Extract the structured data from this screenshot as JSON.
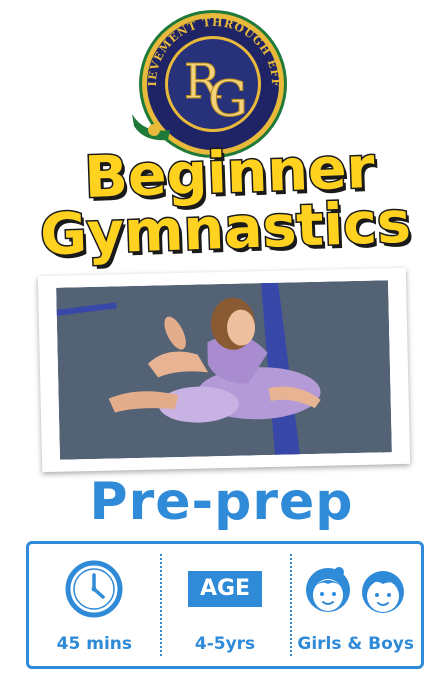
{
  "logo": {
    "motto": "ACHIEVEMENT THROUGH EFFORT",
    "monogram_r": "R",
    "monogram_g": "G"
  },
  "title": {
    "line1": "Beginner",
    "line2": "Gymnastics"
  },
  "subtitle": "Pre-prep",
  "info": {
    "duration": {
      "icon": "clock-icon",
      "label": "45 mins"
    },
    "age": {
      "badge": "AGE",
      "label": "4-5yrs"
    },
    "audience": {
      "icon": "girl-boy-faces-icon",
      "label": "Girls & Boys"
    }
  },
  "colors": {
    "title_yellow": "#ffd21f",
    "brand_blue": "#2f8ad8",
    "logo_navy": "#27327a",
    "logo_gold": "#e8b93a",
    "logo_green": "#1f7a3a"
  }
}
